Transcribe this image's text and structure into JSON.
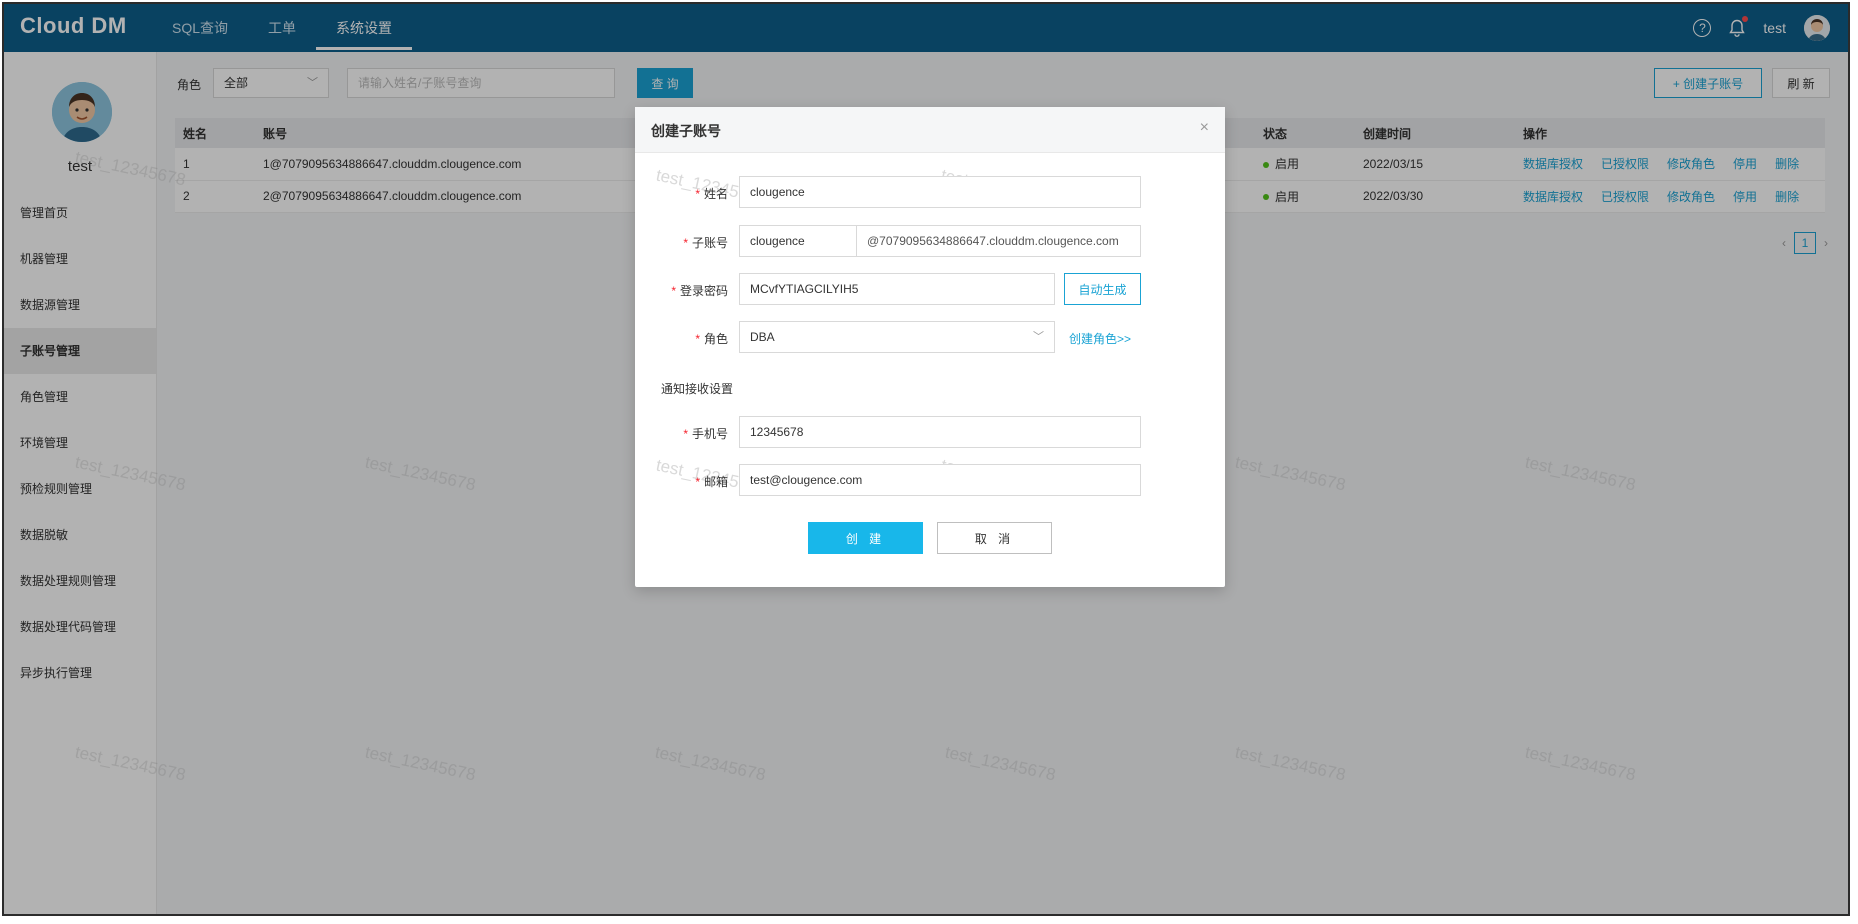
{
  "app": {
    "logo": "Cloud DM"
  },
  "topnav": {
    "tabs": [
      {
        "label": "SQL查询"
      },
      {
        "label": "工单"
      },
      {
        "label": "系统设置"
      }
    ]
  },
  "user": {
    "name": "test"
  },
  "sidebar": {
    "items": [
      {
        "label": "管理首页"
      },
      {
        "label": "机器管理"
      },
      {
        "label": "数据源管理"
      },
      {
        "label": "子账号管理"
      },
      {
        "label": "角色管理"
      },
      {
        "label": "环境管理"
      },
      {
        "label": "预检规则管理"
      },
      {
        "label": "数据脱敏"
      },
      {
        "label": "数据处理规则管理"
      },
      {
        "label": "数据处理代码管理"
      },
      {
        "label": "异步执行管理"
      }
    ]
  },
  "filter": {
    "role_label": "角色",
    "role_value": "全部",
    "search_placeholder": "请输入姓名/子账号查询",
    "query_label": "查 询",
    "create_label": "+ 创建子账号",
    "refresh_label": "刷 新"
  },
  "table": {
    "headers": {
      "name": "姓名",
      "account": "账号",
      "status": "状态",
      "created": "创建时间",
      "actions": "操作"
    },
    "rows": [
      {
        "name": "1",
        "account": "1@7079095634886647.clouddm.clougence.com",
        "status": "启用",
        "created": "2022/03/15"
      },
      {
        "name": "2",
        "account": "2@7079095634886647.clouddm.clougence.com",
        "status": "启用",
        "created": "2022/03/30"
      }
    ],
    "actions": {
      "db_grant": "数据库授权",
      "granted": "已授权限",
      "edit_role": "修改角色",
      "disable": "停用",
      "delete": "删除"
    }
  },
  "pager": {
    "current": "1"
  },
  "watermark": "test_12345678",
  "modal": {
    "title": "创建子账号",
    "name_label": "姓名",
    "name_value": "clougence",
    "account_label": "子账号",
    "account_value": "clougence",
    "account_suffix": "@7079095634886647.clouddm.clougence.com",
    "password_label": "登录密码",
    "password_value": "MCvfYTIAGCILYIH5",
    "auto_gen_label": "自动生成",
    "role_label": "角色",
    "role_value": "DBA",
    "create_role_link": "创建角色>>",
    "notify_title": "通知接收设置",
    "phone_label": "手机号",
    "phone_value": "12345678",
    "email_label": "邮箱",
    "email_value": "test@clougence.com",
    "submit_label": "创 建",
    "cancel_label": "取 消"
  }
}
